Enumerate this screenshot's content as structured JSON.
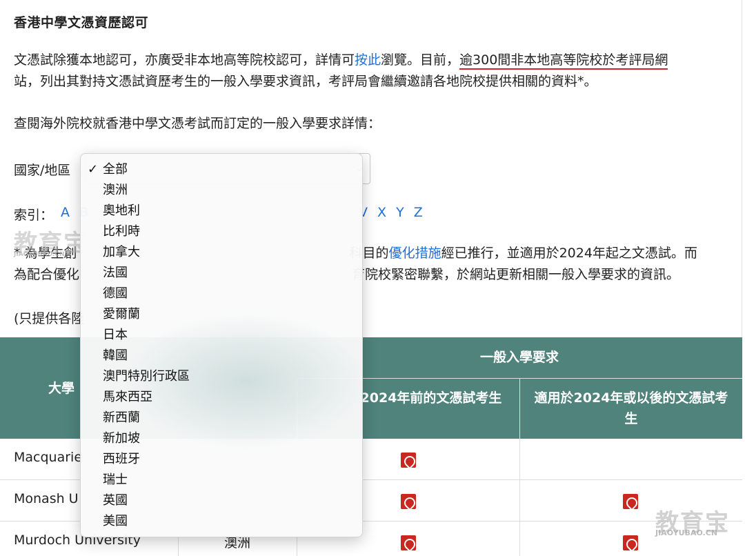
{
  "heading": "香港中學文憑資歷認可",
  "intro": {
    "line1_a": "文憑試除獲本地認可，亦廣受非本地高等院校認可，詳情可",
    "line1_link": "按此",
    "line1_b": "瀏覽。目前，",
    "line1_underlined": "逾300間非本地高等院校於考評局網",
    "line2": "站，列出其對持文憑試資歷考生的一般入學要求資訊，考評局會繼續邀請各地院校提供相關的資料*。"
  },
  "lookup_text": "查閱海外院校就香港中學文憑考試而訂定的一般入學要求詳情：",
  "filter": {
    "label": "國家/地區",
    "chevron": "⌄"
  },
  "index": {
    "label": "索引：",
    "letters_left": "A B",
    "letters_right": "V X Y Z"
  },
  "note": {
    "line1_a": "* 為學生創",
    "line1_b": "科目的",
    "line1_link": "優化措施",
    "line1_c": "經已推行，並適用於2024年起之文憑試。而",
    "line2_a": "為配合優化",
    "line2_b": "育院校緊密聯繫，於網站更新相關一般入學要求的資訊。"
  },
  "note3": "(只提供各陸",
  "watermark": {
    "cn": "教育宝",
    "url": "JIAOYUBAO.CN"
  },
  "table": {
    "header_general": "一般入學要求",
    "header_uni": "大學",
    "header_pre": "2024年前的文憑試考生",
    "header_post": "適用於2024年或以後的文憑試考生",
    "rows": [
      {
        "name": "Macquarie",
        "region": "",
        "pre_pdf": true,
        "post_pdf": false
      },
      {
        "name": "Monash U",
        "region": "",
        "pre_pdf": true,
        "post_pdf": true
      },
      {
        "name": "Murdoch University",
        "region": "澳洲",
        "pre_pdf": true,
        "post_pdf": true
      }
    ]
  },
  "dropdown": {
    "selected_mark": "✓",
    "options": [
      "全部",
      "澳洲",
      "奧地利",
      "比利時",
      "加拿大",
      "法國",
      "德國",
      "愛爾蘭",
      "日本",
      "韓國",
      "澳門特別行政區",
      "馬來西亞",
      "新西蘭",
      "新加坡",
      "西班牙",
      "瑞士",
      "英國",
      "美國"
    ],
    "selected_index": 0
  },
  "colors": {
    "table_header": "#4f837c",
    "link": "#1e6fd9",
    "underline": "#d21f2a",
    "pdf": "#c8281f"
  }
}
